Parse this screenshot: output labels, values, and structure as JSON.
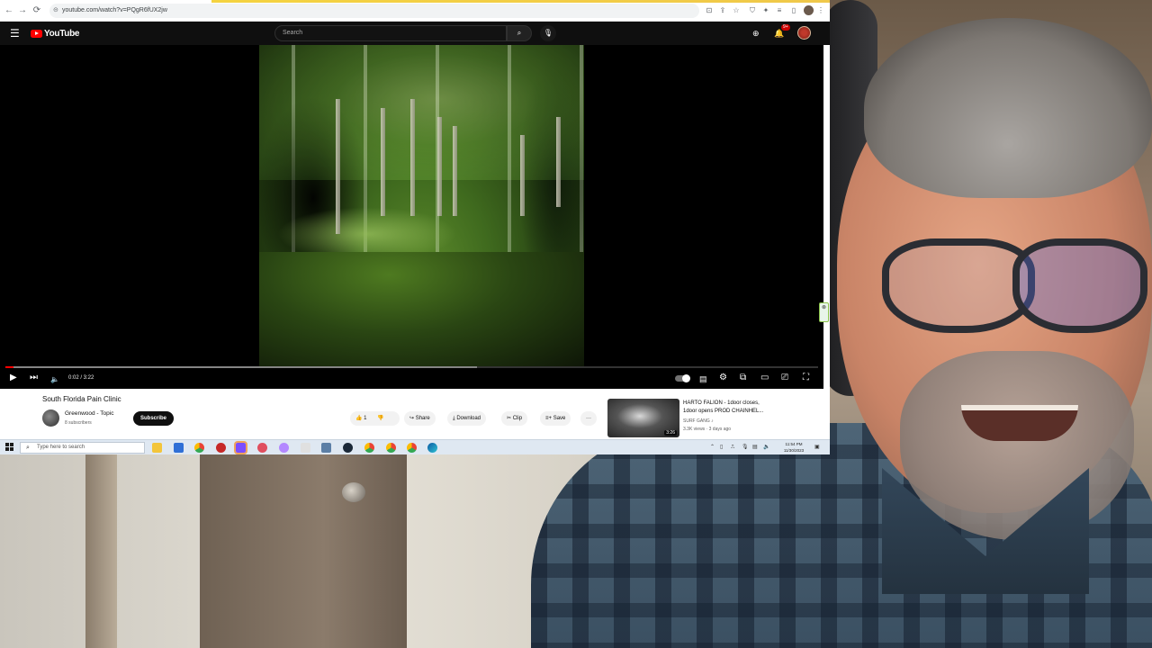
{
  "browser": {
    "url": "youtube.com/watch?v=PQgR6fUX2jw",
    "back": "←",
    "forward": "→",
    "reload": "⟳",
    "lock": "⊝",
    "menu": "⋮"
  },
  "youtube": {
    "logo_text": "YouTube",
    "search_placeholder": "Search",
    "notification_count": "9+"
  },
  "player": {
    "time_current": "0:02",
    "time_total": "3:22",
    "time_display": "0:02 / 3:22",
    "progress_fraction": 0.01,
    "buffer_fraction": 0.58
  },
  "video": {
    "title": "South Florida Pain Clinic",
    "channel": "Greenwood - Topic",
    "subscribers": "8 subscribers",
    "subscribe_label": "Subscribe",
    "like_count": "1",
    "share_label": "Share",
    "download_label": "Download",
    "clip_label": "Clip",
    "save_label": "Save",
    "more_label": "···"
  },
  "recommendation": {
    "title_line1": "HARTO FALION - 1door closes,",
    "title_line2": "1door opens PROD CHAINHEL...",
    "channel": "SURF GANG ♪",
    "meta": "3.3K views · 3 days ago",
    "duration": "3:26"
  },
  "taskbar": {
    "search_placeholder": "Type here to search",
    "time": "11:54 PM",
    "date": "11/30/2023"
  }
}
